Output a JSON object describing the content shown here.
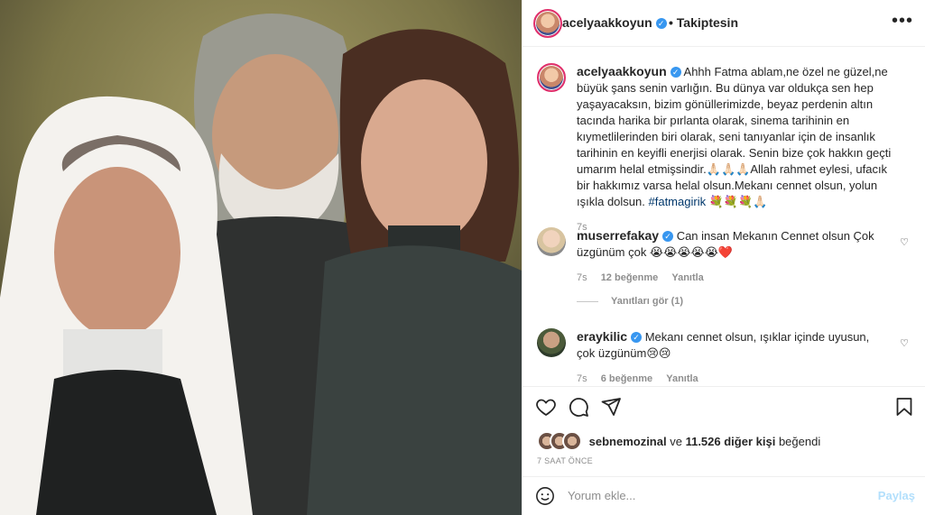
{
  "post_image": {
    "alt": "photo of three people"
  },
  "header": {
    "username": "acelyaakkoyun",
    "follow_status": "Takiptesin",
    "more_icon": "more-horizontal-icon"
  },
  "caption": {
    "username": "acelyaakkoyun",
    "text": "Ahhh Fatma ablam,ne özel ne güzel,ne büyük şans senin varlığın. Bu dünya var oldukça sen hep yaşayacaksın, bizim gönüllerimizde, beyaz perdenin altın tacında harika bir pırlanta olarak, sinema tarihinin en kıymetlilerinden biri olarak, seni tanıyanlar için de insanlık tarihinin en keyifli enerjisi olarak. Senin bize çok hakkın geçti umarım helal etmişsindir.🙏🏻🙏🏻🙏🏻Allah rahmet eylesi, ufacık bir hakkımız varsa helal olsun.Mekanı cennet olsun, yolun ışıkla dolsun.",
    "hashtag": "#fatmagirik",
    "emojis": "💐💐💐🙏🏻",
    "time": "7s"
  },
  "comments": [
    {
      "username": "muserrefakay",
      "text": "Can insan Mekanın Cennet olsun Çok üzgünüm çok 😭😭😭😭😭❤️",
      "time": "7s",
      "likes": "12 beğenme",
      "reply": "Yanıtla",
      "view_replies": "Yanıtları gör (1)"
    },
    {
      "username": "eraykilic",
      "text": "Mekanı cennet olsun, ışıklar içinde uyusun, çok üzgünüm😢😢",
      "time": "7s",
      "likes": "6 beğenme",
      "reply": "Yanıtla"
    }
  ],
  "actions": {
    "like_icon": "heart-icon",
    "comment_icon": "comment-icon",
    "share_icon": "send-icon",
    "save_icon": "bookmark-icon"
  },
  "likes": {
    "first_user": "sebnemozinal",
    "connector": "ve",
    "others": "11.526 diğer kişi",
    "suffix": "beğendi"
  },
  "timestamp": "7 saat önce",
  "add_comment": {
    "placeholder": "Yorum ekle...",
    "post_label": "Paylaş"
  },
  "colors": {
    "accent": "#0095f6",
    "verified": "#3897f0",
    "link": "#00376b",
    "ring": "#e1306c"
  }
}
